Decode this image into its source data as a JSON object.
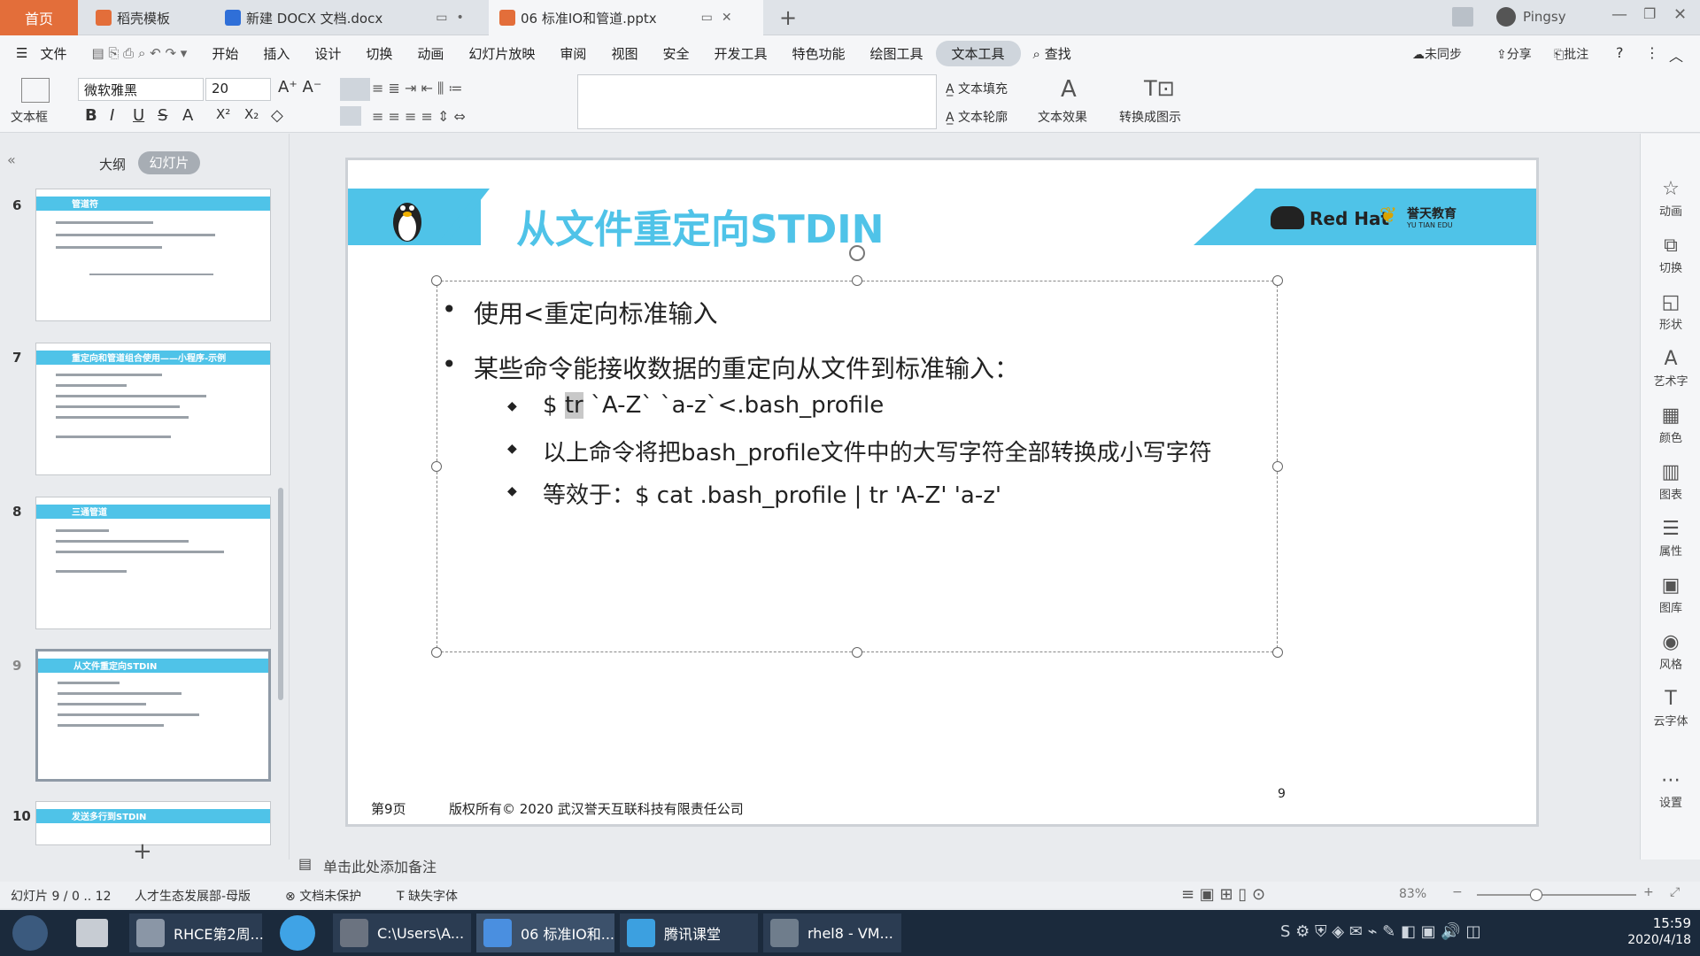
{
  "tabs": {
    "home": "首页",
    "items": [
      {
        "label": "稻壳模板",
        "color": "#e36e3a"
      },
      {
        "label": "新建 DOCX 文档.docx",
        "color": "#2f6fd8"
      },
      {
        "label": "06 标准IO和管道.pptx",
        "color": "#e36e3a"
      }
    ],
    "new_tab": "+",
    "user": "Pingsy"
  },
  "menubar": {
    "file": "文件",
    "items": [
      "开始",
      "插入",
      "设计",
      "切换",
      "动画",
      "幻灯片放映",
      "审阅",
      "视图",
      "安全",
      "开发工具",
      "特色功能",
      "绘图工具",
      "文本工具"
    ],
    "active": "文本工具",
    "search": "查找",
    "sync": "未同步",
    "share": "分享",
    "comment": "批注"
  },
  "ribbon": {
    "textbox": "文本框",
    "font_name": "微软雅黑",
    "font_size": "20",
    "fmt": [
      "B",
      "I",
      "U",
      "S",
      "A",
      "X²",
      "X₂"
    ],
    "big_a": "A",
    "fill": "文本填充",
    "outline": "文本轮廓",
    "effect": "文本效果",
    "convert": "转换成图示"
  },
  "pane": {
    "outline_tab": "大纲",
    "slides_tab": "幻灯片",
    "collapse": "«",
    "add": "+",
    "thumbs": [
      {
        "num": "6",
        "title": "管道符"
      },
      {
        "num": "7",
        "title": "重定向和管道组合使用——小程序-示例"
      },
      {
        "num": "8",
        "title": "三通管道"
      },
      {
        "num": "9",
        "title": "从文件重定向STDIN"
      },
      {
        "num": "10",
        "title": "发送多行到STDIN"
      }
    ]
  },
  "slide": {
    "title": "从文件重定向STDIN",
    "logo1": "Red Hat",
    "logo2": "誉天教育",
    "logo2_sub": "YU TIAN EDU",
    "bullet1": "使用<重定向标准输入",
    "bullet2": "某些命令能接收数据的重定向从文件到标准输入：",
    "sub1_pre": "$ ",
    "sub1_tr": "tr",
    "sub1_rest": " `A-Z` `a-z`<.bash_profile",
    "sub2": "以上命令将把bash_profile文件中的大写字符全部转换成小写字符",
    "sub3": "等效于：$ cat .bash_profile | tr 'A-Z' 'a-z'",
    "footer_page": "第9页",
    "footer_copy": "版权所有© 2020 武汉誉天互联科技有限责任公司",
    "page_num": "9",
    "bullet_dot": "•",
    "sub_dot": "◆"
  },
  "notes": "单击此处添加备注",
  "rightbar": [
    "动画",
    "切换",
    "形状",
    "艺术字",
    "颜色",
    "图表",
    "属性",
    "图库",
    "风格",
    "云字体",
    "设置"
  ],
  "status": {
    "slide": "幻灯片 9 / 0 .. 12",
    "template": "人才生态发展部-母版",
    "protect": "文档未保护",
    "missing_font": "缺失字体",
    "zoom": "83%"
  },
  "taskbar": {
    "items": [
      "RHCE第2周...",
      "C:\\Users\\A...",
      "06 标准IO和...",
      "腾讯课堂",
      "rhel8 - VM..."
    ],
    "time": "15:59",
    "date": "2020/4/18"
  },
  "colors": {
    "accent": "#4fc3e8",
    "title": "#4fc3e8",
    "home_tab": "#e36e3a"
  }
}
